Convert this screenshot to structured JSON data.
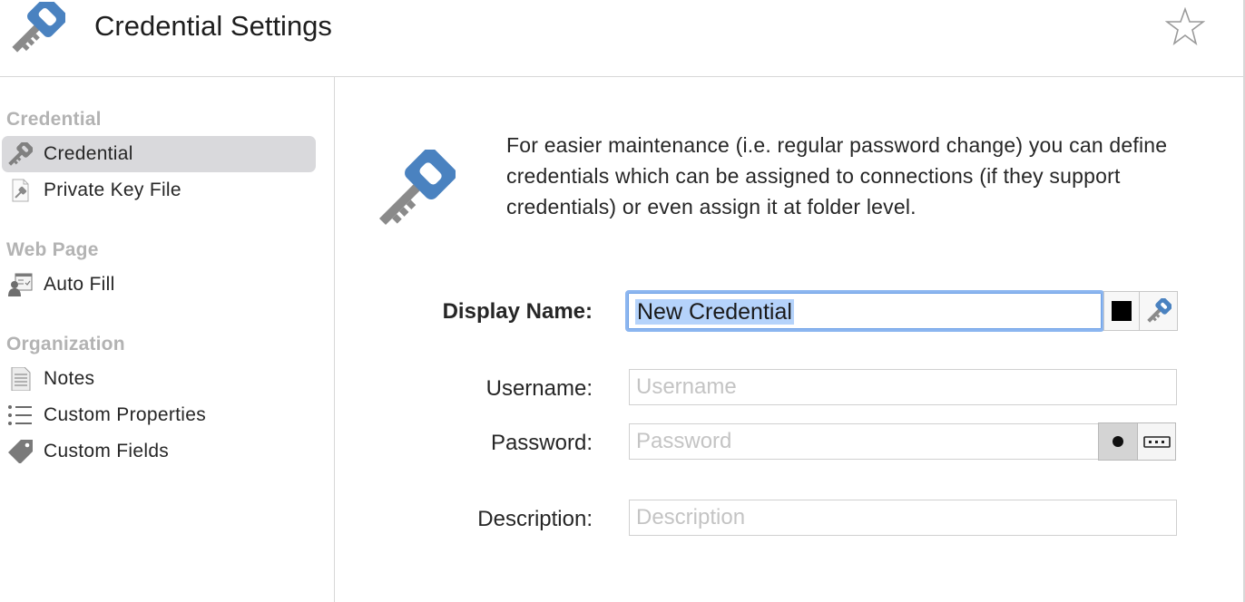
{
  "header": {
    "title": "Credential Settings",
    "app_icon": "key-icon",
    "favorite_icon": "star-icon"
  },
  "sidebar": {
    "groups": [
      {
        "title": "Credential",
        "items": [
          {
            "label": "Credential",
            "icon": "key-icon",
            "selected": true
          },
          {
            "label": "Private Key File",
            "icon": "key-file-icon",
            "selected": false
          }
        ]
      },
      {
        "title": "Web Page",
        "items": [
          {
            "label": "Auto Fill",
            "icon": "auto-fill-icon",
            "selected": false
          }
        ]
      },
      {
        "title": "Organization",
        "items": [
          {
            "label": "Notes",
            "icon": "notes-icon",
            "selected": false
          },
          {
            "label": "Custom Properties",
            "icon": "list-icon",
            "selected": false
          },
          {
            "label": "Custom Fields",
            "icon": "tag-icon",
            "selected": false
          }
        ]
      }
    ]
  },
  "main": {
    "intro": "For easier maintenance (i.e. regular password change) you can define credentials which can be assigned to connections (if they support credentials) or even assign it at folder level.",
    "form": {
      "display_name": {
        "label": "Display Name:",
        "value": "New Credential"
      },
      "username": {
        "label": "Username:",
        "placeholder": "Username"
      },
      "password": {
        "label": "Password:",
        "placeholder": "Password"
      },
      "description": {
        "label": "Description:",
        "placeholder": "Description"
      }
    }
  },
  "colors": {
    "accent_key": "#4a82c0",
    "key_grey": "#8a8a8a",
    "focus_ring": "#8cb6f0",
    "selection": "#b5d3fb",
    "sidebar_selected": "#d9d9dc",
    "group_title": "#b3b3b3"
  }
}
